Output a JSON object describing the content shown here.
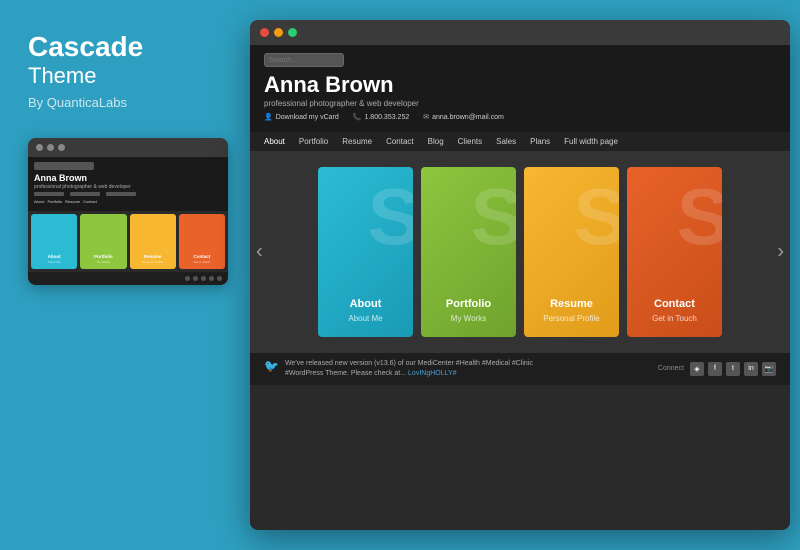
{
  "left": {
    "title": "Cascade",
    "subtitle": "Theme",
    "by": "By QuanticaLabs"
  },
  "small_browser": {
    "dots": [
      "dot1",
      "dot2",
      "dot3"
    ],
    "site_name": "Anna Brown",
    "site_desc": "professional photographer & web developer",
    "nav_items": [
      "About",
      "Portfolio",
      "Resume",
      "Contact"
    ],
    "cards": [
      {
        "label": "About",
        "sub": "About Me",
        "color": "#2bbcd4"
      },
      {
        "label": "Portfolio",
        "sub": "My Works",
        "color": "#8dc63f"
      },
      {
        "label": "Resume",
        "sub": "Personal Profile",
        "color": "#f7b731"
      },
      {
        "label": "Contact",
        "sub": "Get in Touch",
        "color": "#e8622a"
      }
    ]
  },
  "large_browser": {
    "dots": [
      {
        "class": "red"
      },
      {
        "class": "yellow"
      },
      {
        "class": "green"
      }
    ],
    "site_name": "Anna Brown",
    "site_desc": "professional photographer & web developer",
    "meta": [
      {
        "icon": "👤",
        "text": "Download my vCard"
      },
      {
        "icon": "📞",
        "text": "1.800.353.252"
      },
      {
        "icon": "✉",
        "text": "anna.brown@mail.com"
      }
    ],
    "nav_items": [
      "About",
      "Portfolio",
      "Resume",
      "Contact",
      "Blog",
      "Clients",
      "Sales",
      "Plans",
      "Full width page"
    ],
    "cards": [
      {
        "label": "About",
        "sub": "About Me",
        "color": "#2bbcd4",
        "watermark": "S"
      },
      {
        "label": "Portfolio",
        "sub": "My Works",
        "color": "#8dc63f",
        "watermark": "S"
      },
      {
        "label": "Resume",
        "sub": "Personal Profile",
        "color": "#f7b731",
        "watermark": "S"
      },
      {
        "label": "Contact",
        "sub": "Get in Touch",
        "color": "#e8622a",
        "watermark": "S"
      }
    ],
    "footer": {
      "tweet_text": "We've released new version (v13.6) of our MediCenter #Health #Medical #Clinic #WordPress Theme. Please check at...",
      "tweet_link": "LovINgHOLLY#",
      "connect_label": "Connect",
      "connect_icons": [
        "RSS",
        "f",
        "t",
        "in",
        "📷"
      ]
    },
    "search_placeholder": "Search..."
  }
}
